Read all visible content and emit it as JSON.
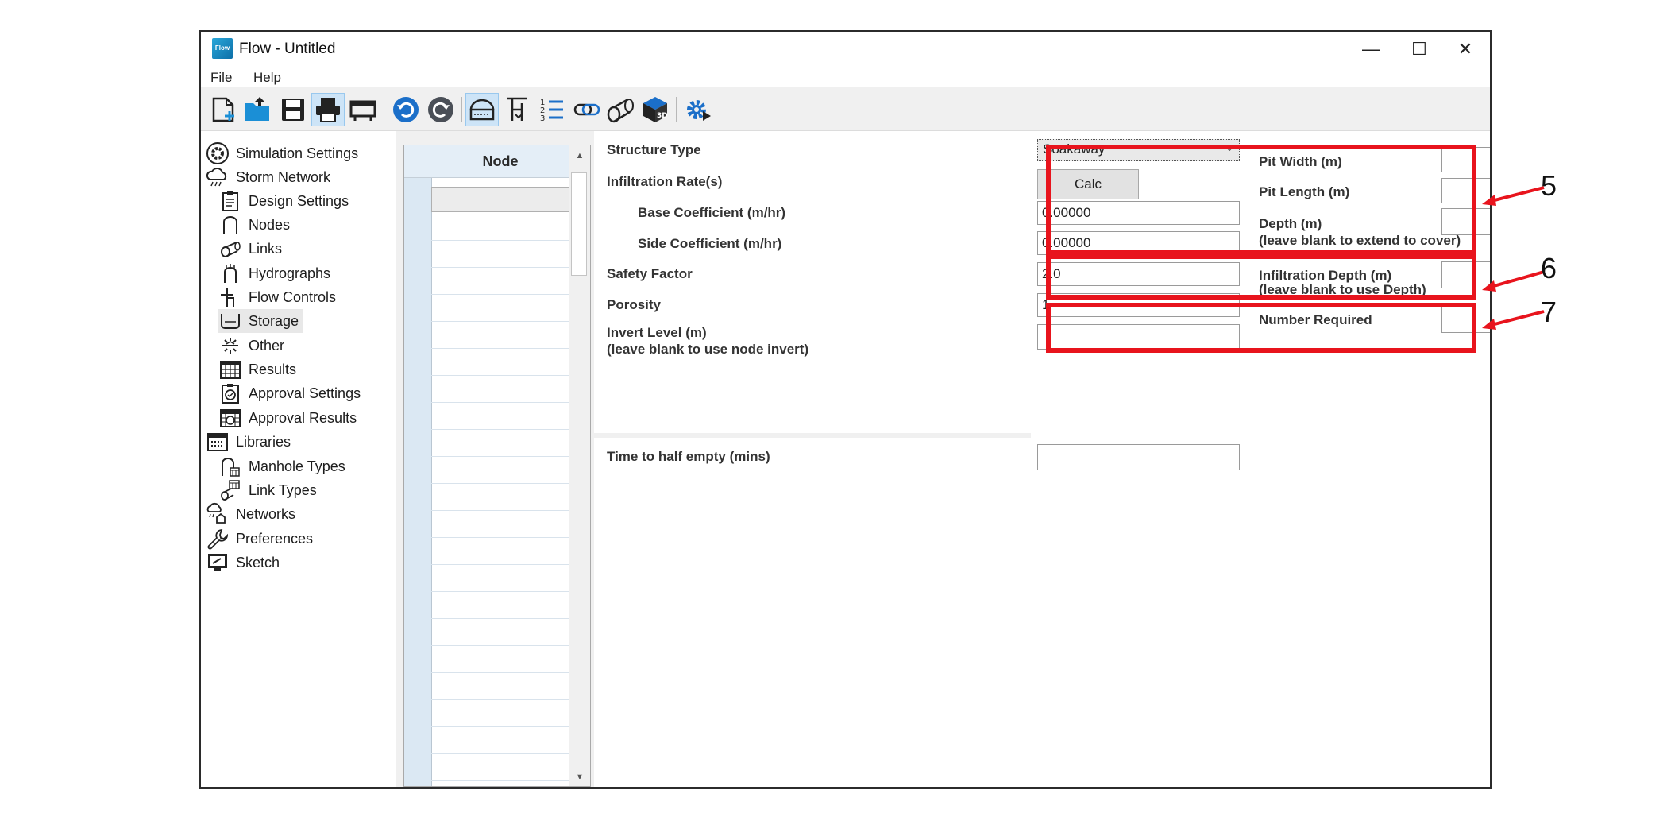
{
  "window": {
    "title": "Flow - Untitled",
    "icon_text": "Flow",
    "controls": {
      "minimize": "—",
      "maximize": "☐",
      "close": "✕"
    }
  },
  "menu": {
    "file": "File",
    "help": "Help"
  },
  "toolbar": {
    "buttons": [
      "new-file-icon",
      "open-folder-icon",
      "save-icon",
      "print-icon",
      "print-preview-icon",
      "undo-icon",
      "redo-icon",
      "storage-view-icon",
      "flow-control-icon",
      "numbered-list-icon",
      "link-icon",
      "pipe-icon",
      "3d-box-icon",
      "settings-gear-icon"
    ]
  },
  "tree": {
    "items": [
      {
        "label": "Simulation Settings",
        "icon": "gear-circle-icon"
      },
      {
        "label": "Storm Network",
        "icon": "storm-cloud-icon"
      },
      {
        "label": "Design Settings",
        "icon": "clipboard-icon"
      },
      {
        "label": "Nodes",
        "icon": "node-cylinder-icon"
      },
      {
        "label": "Links",
        "icon": "pipe-link-icon"
      },
      {
        "label": "Hydrographs",
        "icon": "hydrograph-icon"
      },
      {
        "label": "Flow Controls",
        "icon": "flow-control-icon"
      },
      {
        "label": "Storage",
        "icon": "storage-tank-icon"
      },
      {
        "label": "Other",
        "icon": "other-arrows-icon"
      },
      {
        "label": "Results",
        "icon": "results-table-icon"
      },
      {
        "label": "Approval Settings",
        "icon": "approval-settings-icon"
      },
      {
        "label": "Approval Results",
        "icon": "approval-results-icon"
      },
      {
        "label": "Libraries",
        "icon": "library-icon"
      },
      {
        "label": "Manhole Types",
        "icon": "manhole-type-icon"
      },
      {
        "label": "Link Types",
        "icon": "link-type-icon"
      },
      {
        "label": "Networks",
        "icon": "network-icon"
      },
      {
        "label": "Preferences",
        "icon": "wrench-icon"
      },
      {
        "label": "Sketch",
        "icon": "sketch-monitor-icon"
      }
    ],
    "selected": "Storage"
  },
  "grid": {
    "column_header": "Node"
  },
  "form": {
    "structure_type_label": "Structure Type",
    "structure_type_value": "Soakaway",
    "infiltration_label": "Infiltration Rate(s)",
    "calc_button": "Calc",
    "base_coeff_label": "Base Coefficient (m/hr)",
    "base_coeff_value": "0.00000",
    "side_coeff_label": "Side Coefficient (m/hr)",
    "side_coeff_value": "0.00000",
    "safety_factor_label": "Safety Factor",
    "safety_factor_value": "2.0",
    "porosity_label": "Porosity",
    "porosity_value": "1",
    "invert_label_1": "Invert Level (m)",
    "invert_label_2": "(leave blank to use node invert)",
    "invert_value": "",
    "time_half_label": "Time to half empty (mins)",
    "time_half_value": "",
    "pit_width_label": "Pit Width (m)",
    "pit_width_value": "",
    "pit_length_label": "Pit Length (m)",
    "pit_length_value": "",
    "depth_label_1": "Depth (m)",
    "depth_label_2": "(leave blank to extend to cover)",
    "depth_value": "",
    "infil_depth_label_1": "Infiltration Depth (m)",
    "infil_depth_label_2": "(leave blank to use Depth)",
    "infil_depth_value": "",
    "number_required_label": "Number Required",
    "number_required_value": ""
  },
  "callouts": {
    "five": "5",
    "six": "6",
    "seven": "7",
    "highlight_color": "#e8141d"
  }
}
